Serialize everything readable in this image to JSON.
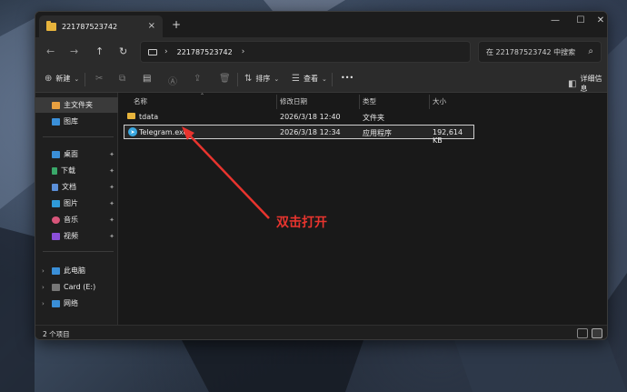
{
  "window": {
    "tab_title": "221787523742",
    "tab_close": "×",
    "new_tab": "+",
    "controls": {
      "minimize": "—",
      "maximize": "☐",
      "close": "✕"
    }
  },
  "nav": {
    "back": "←",
    "forward": "→",
    "up": "↑",
    "refresh": "↻",
    "address": "221787523742",
    "address_chevron": "›",
    "search_placeholder": "在 221787523742 中搜索"
  },
  "toolbar": {
    "new_label": "新建",
    "sort_label": "排序",
    "view_label": "查看",
    "more": "•••",
    "details_label": "详细信息"
  },
  "sidebar": {
    "home": "主文件夹",
    "gallery": "图库",
    "items": [
      {
        "label": "桌面",
        "color": "#3a8fd8"
      },
      {
        "label": "下载",
        "color": "#3aa86a"
      },
      {
        "label": "文档",
        "color": "#5b8fd8"
      },
      {
        "label": "图片",
        "color": "#2f9ad8"
      },
      {
        "label": "音乐",
        "color": "#d8557a"
      },
      {
        "label": "视频",
        "color": "#8a4fd8"
      }
    ],
    "drives": [
      {
        "label": "此电脑"
      },
      {
        "label": "Card (E:)"
      },
      {
        "label": "网络"
      }
    ]
  },
  "columns": {
    "name": "名称",
    "date": "修改日期",
    "type": "类型",
    "size": "大小"
  },
  "files": [
    {
      "name": "tdata",
      "date": "2026/3/18 12:40",
      "type": "文件夹",
      "size": ""
    },
    {
      "name": "Telegram.exe",
      "date": "2026/3/18 12:34",
      "type": "应用程序",
      "size": "192,614 KB"
    }
  ],
  "status": {
    "count": "2 个项目"
  },
  "annotation": {
    "text": "双击打开",
    "color": "#e8342e"
  }
}
